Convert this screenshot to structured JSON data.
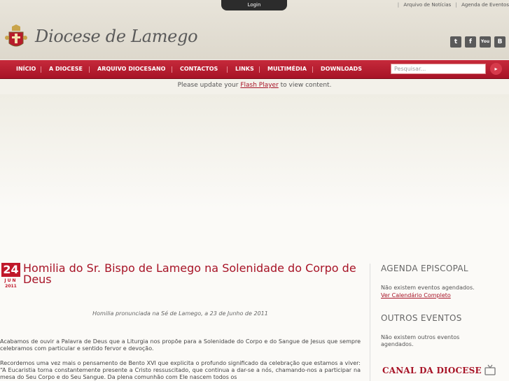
{
  "header": {
    "login_label": "Login",
    "top_links": [
      "Arquivo de Notícias",
      "Agenda de Eventos"
    ],
    "site_title": "Diocese de Lamego",
    "social": [
      {
        "name": "twitter-icon",
        "glyph": "t"
      },
      {
        "name": "facebook-icon",
        "glyph": "f"
      },
      {
        "name": "youtube-icon",
        "glyph": "You"
      },
      {
        "name": "blogger-icon",
        "glyph": "B"
      }
    ]
  },
  "nav": {
    "items": [
      "INÍCIO",
      "A DIOCESE",
      "ARQUIVO DIOCESANO",
      "CONTACTOS",
      "LINKS",
      "MULTIMÉDIA",
      "DOWNLOADS"
    ],
    "search_placeholder": "Pesquisar..."
  },
  "flash": {
    "before": "Please update your ",
    "link": "Flash Player",
    "after": " to view content."
  },
  "article": {
    "day": "24",
    "month": "JUN",
    "year": "2011",
    "title": "Homilia do Sr. Bispo de Lamego na Solenidade do Corpo de Deus",
    "subtitle": "Homilia pronunciada na Sé de Lamego, a 23 de Junho de 2011",
    "p1": "Acabamos de ouvir a Palavra de Deus que a Liturgia nos propõe para a Solenidade do Corpo e do Sangue de Jesus que sempre celebramos com particular e sentido fervor e devoção.",
    "p2": "Recordemos uma vez mais o pensamento de Bento XVI que explicita o profundo significado da celebração que estamos a viver: “A Eucaristia torna constantemente presente a Cristo ressuscitado, que continua a dar-se a nós, chamando-nos a participar na mesa do Seu Corpo e do Seu Sangue. Da plena comunhão com Ele nascem todos os"
  },
  "sidebar": {
    "agenda_title": "AGENDA EPISCOPAL",
    "agenda_text": "Não existem eventos agendados.",
    "agenda_link": "Ver Calendário Completo",
    "outros_title": "OUTROS EVENTOS",
    "outros_text": "Não existem outros eventos agendados.",
    "canal_title": "CANAL DA DIOCESE"
  },
  "colors": {
    "accent": "#a71326",
    "nav": "#c0182a"
  }
}
